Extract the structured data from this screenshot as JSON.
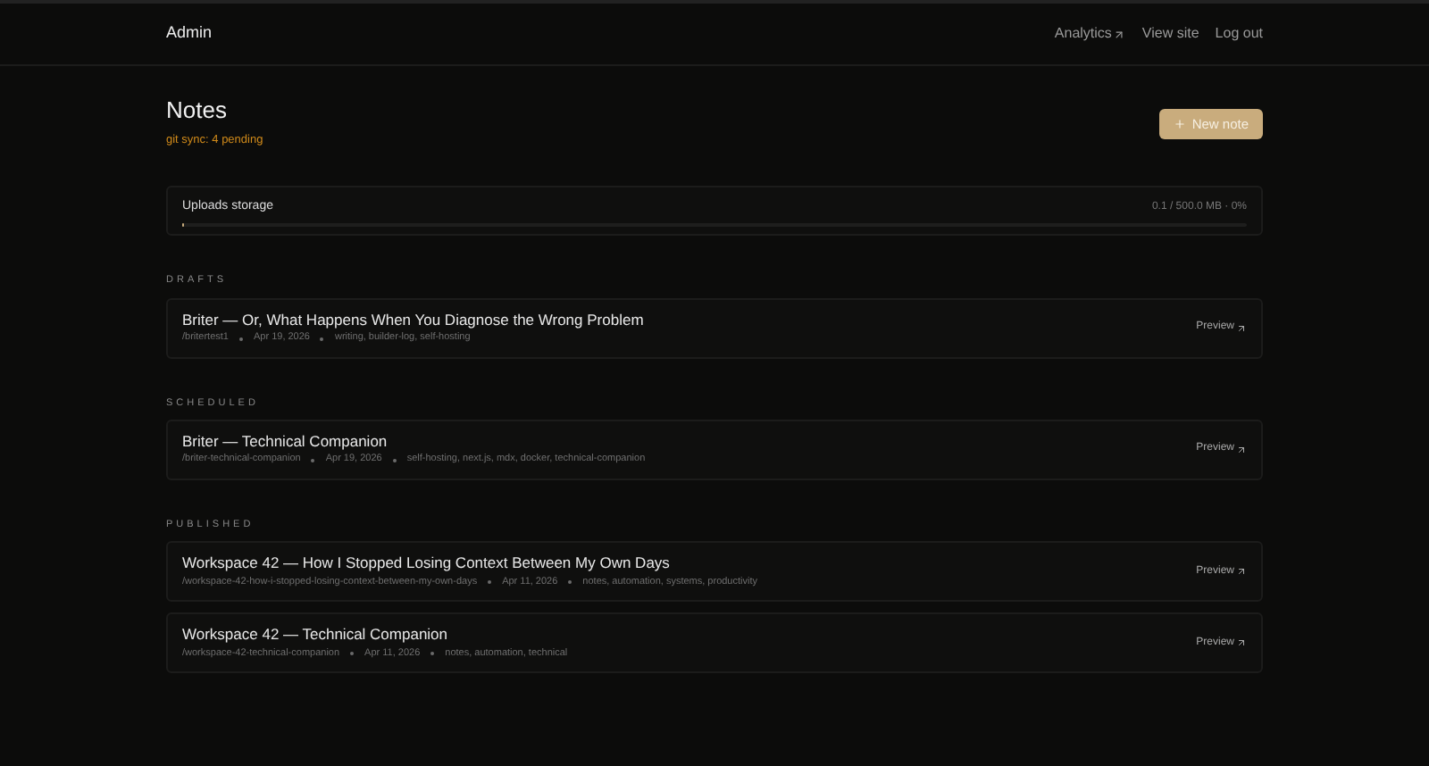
{
  "header": {
    "title": "Admin",
    "links": [
      {
        "label": "Analytics",
        "external": true
      },
      {
        "label": "View site",
        "external": false
      },
      {
        "label": "Log out",
        "external": false
      }
    ]
  },
  "page": {
    "title": "Notes",
    "sync_status": "git sync: 4 pending",
    "new_button": "New note"
  },
  "storage": {
    "label": "Uploads storage",
    "reading": "0.1 / 500.0 MB · 0%",
    "level": 0.0002
  },
  "sections": [
    {
      "heading": "DRAFTS",
      "notes": [
        {
          "title": "Briter — Or, What Happens When You Diagnose the Wrong Problem",
          "slug": "/britertest1",
          "date": "Apr 19, 2026",
          "tags": "writing, builder-log, self-hosting",
          "action": "Preview"
        }
      ]
    },
    {
      "heading": "SCHEDULED",
      "notes": [
        {
          "title": "Briter — Technical Companion",
          "slug": "/briter-technical-companion",
          "date": "Apr 19, 2026",
          "tags": "self-hosting, next.js, mdx, docker, technical-companion",
          "action": "Preview"
        }
      ]
    },
    {
      "heading": "PUBLISHED",
      "notes": [
        {
          "title": "Workspace 42 — How I Stopped Losing Context Between My Own Days",
          "slug": "/workspace-42-how-i-stopped-losing-context-between-my-own-days",
          "date": "Apr 11, 2026",
          "tags": "notes, automation, systems, productivity",
          "action": "Preview"
        },
        {
          "title": "Workspace 42 — Technical Companion",
          "slug": "/workspace-42-technical-companion",
          "date": "Apr 11, 2026",
          "tags": "notes, automation, technical",
          "action": "Preview"
        }
      ]
    }
  ]
}
